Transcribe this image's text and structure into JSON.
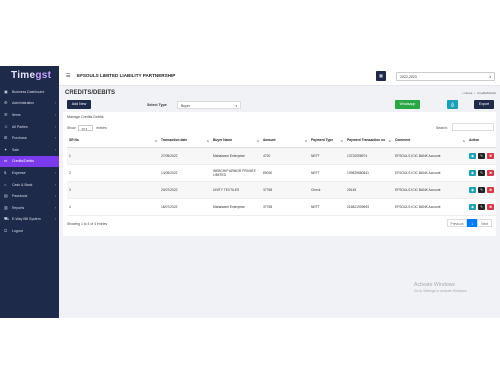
{
  "app": {
    "logo": "Time",
    "logo_accent": "gst"
  },
  "sidebar": {
    "items": [
      {
        "label": "Business Dashboard",
        "icon": "dashboard-icon",
        "chevron": false
      },
      {
        "label": "Administration",
        "icon": "admin-icon",
        "chevron": true
      },
      {
        "label": "Items",
        "icon": "items-icon",
        "chevron": true
      },
      {
        "label": "All Parties",
        "icon": "parties-icon",
        "chevron": true
      },
      {
        "label": "Purchase",
        "icon": "cart-icon",
        "chevron": true
      },
      {
        "label": "Sale",
        "icon": "sale-icon",
        "chevron": true
      },
      {
        "label": "Credits/Debits",
        "icon": "credit-icon",
        "chevron": false,
        "active": true
      },
      {
        "label": "Expense",
        "icon": "expense-icon",
        "chevron": true
      },
      {
        "label": "Cash & Bank",
        "icon": "bank-icon",
        "chevron": true
      },
      {
        "label": "Passbook",
        "icon": "book-icon",
        "chevron": true
      },
      {
        "label": "Reports",
        "icon": "reports-icon",
        "chevron": true
      },
      {
        "label": "E-Way Bill System",
        "icon": "truck-icon",
        "chevron": true
      },
      {
        "label": "Logout",
        "icon": "logout-icon",
        "chevron": false
      }
    ]
  },
  "topbar": {
    "company": "EFSOULS LIMITED LIABILITY PARTNERSHIP",
    "year": "2022-2023"
  },
  "page": {
    "title": "CREDITS/DEBITS",
    "breadcrumb_home": "Home",
    "breadcrumb_current": "Credits/Debits"
  },
  "toolbar": {
    "add_label": "Add New",
    "select_type_label": "Select Type",
    "select_type_value": "Buyer",
    "whatsapp_label": "Whatsapp",
    "export_label": "Export"
  },
  "card": {
    "title": "Manage Credits Debits",
    "show_label": "Show",
    "show_value": "10",
    "entries_label": "entries",
    "search_label": "Search:",
    "columns": [
      "SR No",
      "Transaction date",
      "Buyer Name",
      "Amount",
      "Payment Type",
      "Payment Transaction no",
      "Comment",
      "Action"
    ],
    "rows": [
      {
        "sr": "1",
        "date": "27/09/2022",
        "buyer": "Mahalaxmi Enterprise",
        "amount": "4720",
        "ptype": "NEFT",
        "txn": "13720098974",
        "comment": "EFSOULS ICIC BANK Account"
      },
      {
        "sr": "2",
        "date": "14/09/2022",
        "buyer": "WEBCHIP ARMOR PRIVATE LIMITED",
        "amount": "89030",
        "ptype": "NEFT",
        "txn": "109829880841",
        "comment": "EFSOULS ICIC BANK Account"
      },
      {
        "sr": "3",
        "date": "20/07/2022",
        "buyer": "UNITY TEXTILES",
        "amount": "37768",
        "ptype": "Check",
        "txn": "25145",
        "comment": "EFSOULS ICIC BANK Account"
      },
      {
        "sr": "4",
        "date": "16/07/2022",
        "buyer": "Mahalaxmi Enterprise",
        "amount": "37768",
        "ptype": "NEFT",
        "txn": "216821909693",
        "comment": "EFSOULS ICIC BANK Account"
      }
    ],
    "showing_text": "Showing 1 to 4 of 4 entries",
    "pager": {
      "prev": "Previous",
      "page": "1",
      "next": "Next"
    }
  },
  "watermark": {
    "line1": "Activate Windows",
    "line2": "Go to Settings to activate Windows."
  },
  "colors": {
    "sidebar": "#1e2a4a",
    "active": "#7c3aed",
    "green": "#28a745",
    "cyan": "#17a2b8",
    "red": "#dc3545"
  }
}
